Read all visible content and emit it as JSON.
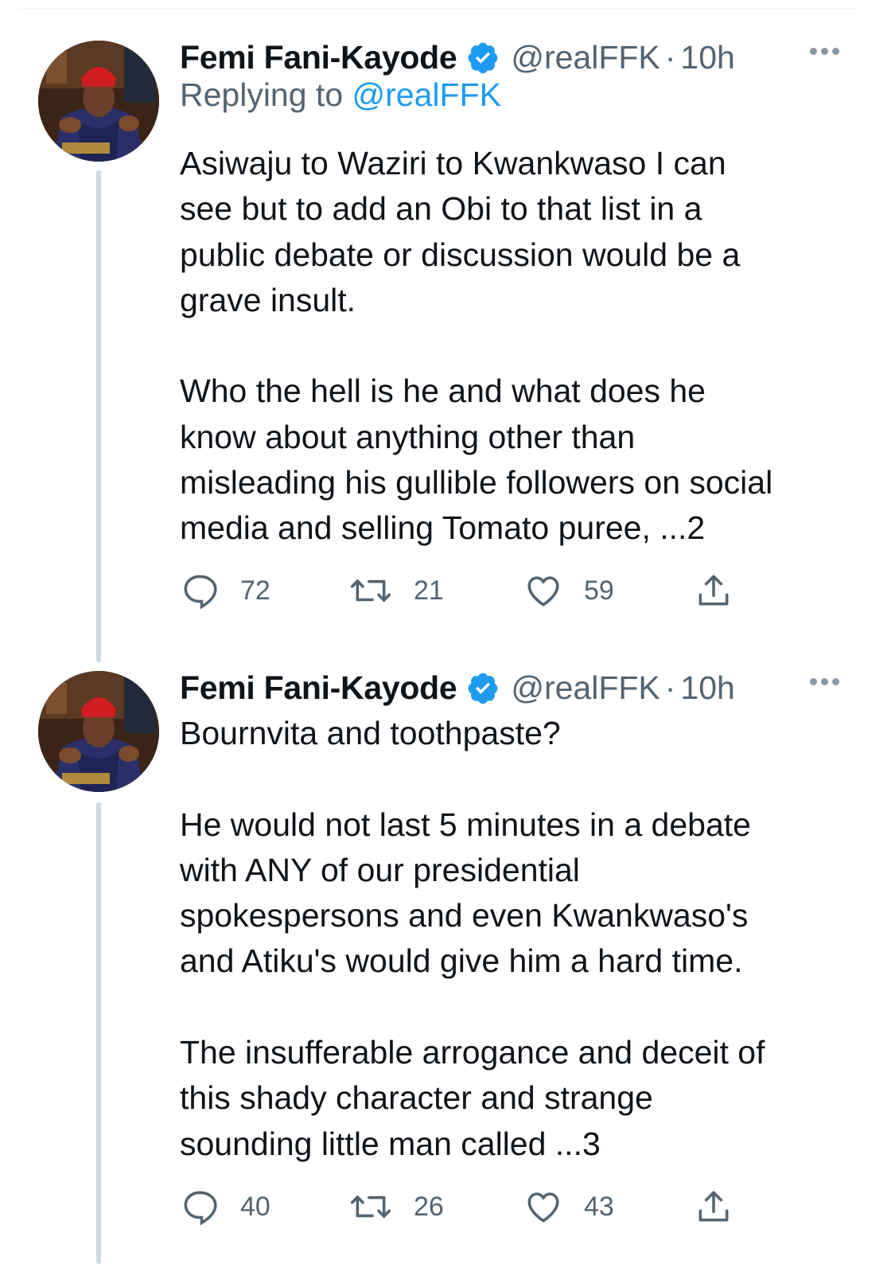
{
  "colors": {
    "text": "#0f1419",
    "secondary": "#536471",
    "link": "#1d9bf0",
    "verified": "#1d9bf0",
    "thread_line": "#cfd9de"
  },
  "tweets": [
    {
      "name": "Femi Fani-Kayode",
      "handle": "@realFFK",
      "separator": "·",
      "time": "10h",
      "replying_prefix": "Replying to",
      "replying_to": "@realFFK",
      "paragraphs": [
        [
          "Asiwaju to Waziri to Kwankwaso I can",
          "see but to add an Obi to that list in a",
          "public debate or discussion would be a",
          "grave insult."
        ],
        [
          "Who the hell is he and what does he",
          "know about anything other than",
          "misleading his gullible followers on social",
          "media and selling Tomato puree, ...2"
        ]
      ],
      "replies": "72",
      "retweets": "21",
      "likes": "59",
      "icons": [
        "verified-badge-icon",
        "more-icon",
        "reply-icon",
        "retweet-icon",
        "like-icon",
        "share-icon"
      ]
    },
    {
      "name": "Femi Fani-Kayode",
      "handle": "@realFFK",
      "separator": "·",
      "time": "10h",
      "paragraphs": [
        [
          "Bournvita and toothpaste?"
        ],
        [
          "He would not last 5 minutes in a debate",
          "with ANY of our presidential",
          "spokespersons and even Kwankwaso's",
          "and Atiku's would give him a hard time."
        ],
        [
          "The insufferable arrogance and deceit of",
          "this shady character and strange",
          "sounding little man called ...3"
        ]
      ],
      "replies": "40",
      "retweets": "26",
      "likes": "43",
      "icons": [
        "verified-badge-icon",
        "more-icon",
        "reply-icon",
        "retweet-icon",
        "like-icon",
        "share-icon"
      ]
    }
  ]
}
